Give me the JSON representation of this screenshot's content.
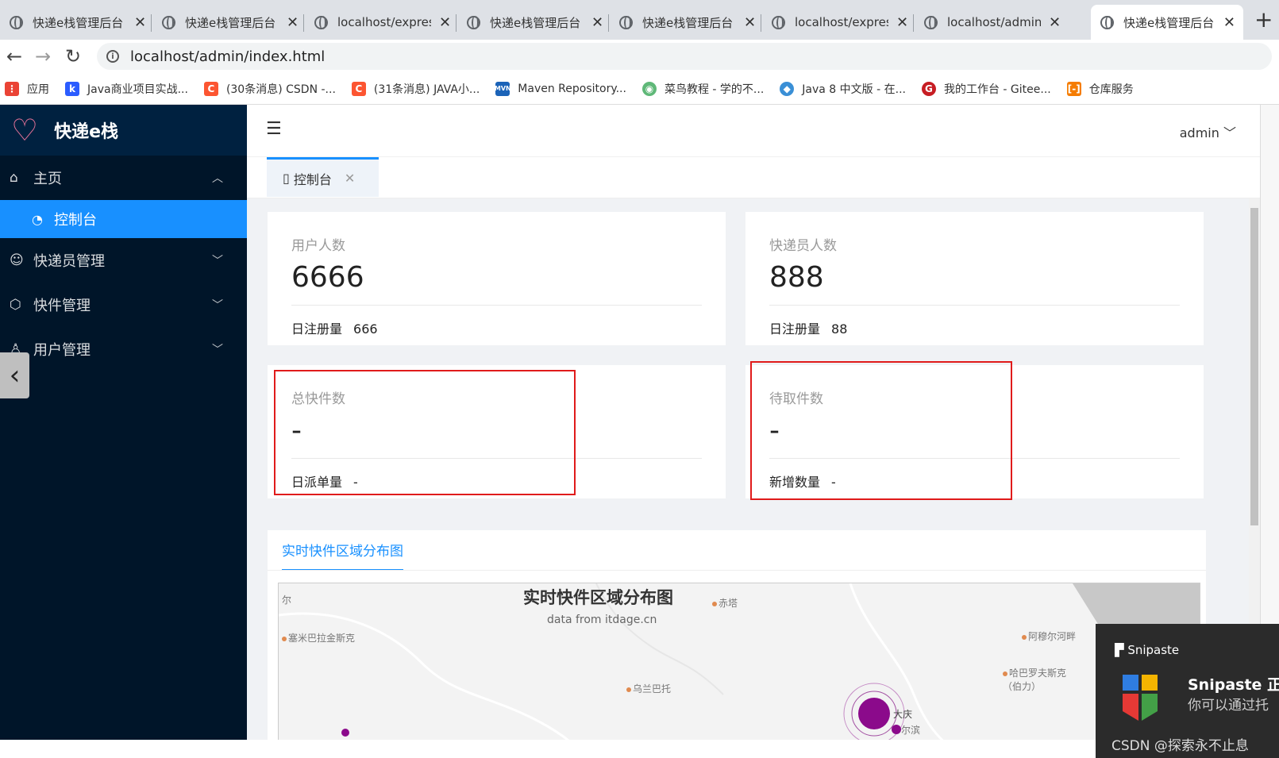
{
  "browser": {
    "tabs": [
      {
        "title": "快递e栈管理后台"
      },
      {
        "title": "快递e栈管理后台"
      },
      {
        "title": "localhost/express"
      },
      {
        "title": "快递e栈管理后台"
      },
      {
        "title": "快递e栈管理后台"
      },
      {
        "title": "localhost/express"
      },
      {
        "title": "localhost/admin"
      },
      {
        "title": "快递e栈管理后台"
      }
    ],
    "close_glyph": "✕",
    "new_tab": "+",
    "url": "localhost/admin/index.html",
    "bookmarks": [
      {
        "label": "应用",
        "color": "#ea4335"
      },
      {
        "label": "Java商业项目实战...",
        "color": "#2b5cff"
      },
      {
        "label": "(30条消息) CSDN -...",
        "color": "#fc5531"
      },
      {
        "label": "(31条消息) JAVA小...",
        "color": "#fc5531"
      },
      {
        "label": "Maven Repository...",
        "color": "#1b63b8"
      },
      {
        "label": "菜鸟教程 - 学的不...",
        "color": "#5fb878"
      },
      {
        "label": "Java 8 中文版 - 在...",
        "color": "#3a8fd6"
      },
      {
        "label": "我的工作台 - Gitee...",
        "color": "#c71d23"
      },
      {
        "label": "仓库服务",
        "color": "#f57c00"
      }
    ]
  },
  "app": {
    "brand": "快递e栈",
    "user": "admin",
    "menu": [
      {
        "label": "主页",
        "icon": "home-icon"
      },
      {
        "label": "快递员管理",
        "icon": "courier-icon"
      },
      {
        "label": "快件管理",
        "icon": "package-icon"
      },
      {
        "label": "用户管理",
        "icon": "user-icon"
      }
    ],
    "submenu_active": "控制台",
    "page_tab": "控制台"
  },
  "cards": [
    {
      "label": "用户人数",
      "value": "6666",
      "foot_label": "日注册量",
      "foot_value": "666"
    },
    {
      "label": "快递员人数",
      "value": "888",
      "foot_label": "日注册量",
      "foot_value": "88"
    },
    {
      "label": "总快件数",
      "value": "-",
      "foot_label": "日派单量",
      "foot_value": "-"
    },
    {
      "label": "待取件数",
      "value": "-",
      "foot_label": "新增数量",
      "foot_value": "-"
    }
  ],
  "map": {
    "tab": "实时快件区域分布图",
    "title": "实时快件区域分布图",
    "subtitle": "data from itdage.cn",
    "cities": [
      "尔",
      "塞米巴拉金斯克",
      "赤塔",
      "乌兰巴托",
      "阿穆尔河畔",
      "哈巴罗夫斯克（伯力）",
      "大庆",
      "尔滨"
    ]
  },
  "snipaste": {
    "head": "Snipaste",
    "title": "Snipaste 正在",
    "text": "你可以通过托"
  },
  "watermark": "CSDN @探索永不止息",
  "colors": {
    "sidebar": "#001529",
    "accent": "#1890ff",
    "highlight": "#e01b1b",
    "bubble": "#8b0a8b"
  }
}
